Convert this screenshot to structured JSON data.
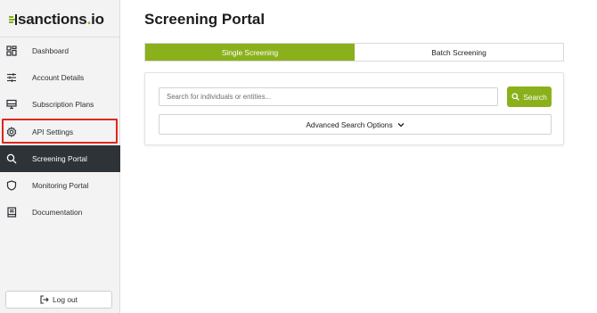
{
  "brand": {
    "name_main": "sanctions",
    "name_dot": ".",
    "name_suffix": "io",
    "accent_color": "#8ab11b"
  },
  "sidebar": {
    "items": [
      {
        "label": "Dashboard",
        "icon": "dashboard-icon"
      },
      {
        "label": "Account Details",
        "icon": "sliders-icon"
      },
      {
        "label": "Subscription Plans",
        "icon": "monitor-icon"
      },
      {
        "label": "API Settings",
        "icon": "gear-icon"
      },
      {
        "label": "Screening Portal",
        "icon": "search-icon",
        "active": true
      },
      {
        "label": "Monitoring Portal",
        "icon": "shield-icon"
      },
      {
        "label": "Documentation",
        "icon": "book-icon"
      }
    ],
    "logout_label": "Log out",
    "highlighted_item": "API Settings",
    "highlight_color": "#e0261c"
  },
  "main": {
    "title": "Screening Portal",
    "tabs": [
      {
        "label": "Single Screening",
        "selected": true
      },
      {
        "label": "Batch Screening",
        "selected": false
      }
    ],
    "search": {
      "placeholder": "Search for individuals or entities...",
      "value": "",
      "button_label": "Search"
    },
    "advanced_label": "Advanced Search Options"
  }
}
